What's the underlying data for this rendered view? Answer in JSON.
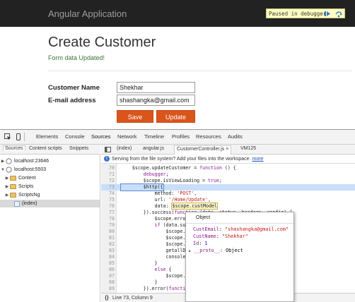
{
  "app": {
    "brand": "Angular Application",
    "debugger_banner": "Paused in debugger",
    "page_title": "Create Customer",
    "status_message": "Form data Updated!",
    "form": {
      "name_label": "Customer Name",
      "name_value": "Shekhar",
      "email_label": "E-mail address",
      "email_value": "shashangka@gmail.com"
    },
    "buttons": {
      "save": "Save",
      "update": "Update"
    }
  },
  "devtools": {
    "main_tabs": [
      "Elements",
      "Console",
      "Sources",
      "Network",
      "Timeline",
      "Profiles",
      "Resources",
      "Audits"
    ],
    "active_tab": "Sources",
    "navigator_tabs": [
      "Sources",
      "Content scripts",
      "Snippets"
    ],
    "tree": [
      {
        "label": "localhost:23646",
        "kind": "host",
        "expanded": false
      },
      {
        "label": "localhost:5503",
        "kind": "host",
        "expanded": true
      },
      {
        "label": "Content",
        "kind": "folder"
      },
      {
        "label": "Scripts",
        "kind": "folder"
      },
      {
        "label": "ScriptsNg",
        "kind": "folder"
      },
      {
        "label": "(index)",
        "kind": "file",
        "selected": true
      }
    ],
    "editor_tabs": [
      "(index)",
      "angular.js",
      "CustomerController.js ×",
      "VM125"
    ],
    "active_editor_tab": "CustomerController.js ×",
    "infobar": {
      "text": "Serving from the file system? Add your files into the workspace.",
      "link": "more"
    },
    "code_lines": [
      {
        "n": "70",
        "text": "    $scope.updateCustomer = function () {"
      },
      {
        "n": "71",
        "text": "        debugger;"
      },
      {
        "n": "72",
        "text": "        $scope.isViewLoading = true;"
      },
      {
        "n": "73",
        "text": "        $http({"
      },
      {
        "n": "74",
        "text": "            method: 'POST',"
      },
      {
        "n": "75",
        "text": "            url: '/Home/Update',"
      },
      {
        "n": "76",
        "text": "            data: $scope.custModel"
      },
      {
        "n": "77",
        "text": "        }).success(function (data, status, headers, config) {"
      },
      {
        "n": "78",
        "text": "            $scope.errors = [];"
      },
      {
        "n": "79",
        "text": "            if (data.success === true) {"
      },
      {
        "n": "80",
        "text": "                $scope."
      },
      {
        "n": "81",
        "text": "                $scope."
      },
      {
        "n": "82",
        "text": "                $scope."
      },
      {
        "n": "83",
        "text": "                getallD"
      },
      {
        "n": "84",
        "text": "                console"
      },
      {
        "n": "85",
        "text": "            }"
      },
      {
        "n": "86",
        "text": "            else {"
      },
      {
        "n": "87",
        "text": "                $scope."
      },
      {
        "n": "88",
        "text": "            }"
      },
      {
        "n": "89",
        "text": "        }).error(function"
      }
    ],
    "current_line": "73",
    "status": "Line 73, Column 9",
    "braces_label": "{}",
    "popover": {
      "title": "Object",
      "props": [
        {
          "key": "CustEmail",
          "value": "\"shashangka@gmail.com\"",
          "type": "string"
        },
        {
          "key": "CustName",
          "value": "\"Shekhar\"",
          "type": "string"
        },
        {
          "key": "Id",
          "value": "1",
          "type": "number"
        },
        {
          "key": "__proto__",
          "value": "Object",
          "type": "object"
        }
      ]
    }
  }
}
